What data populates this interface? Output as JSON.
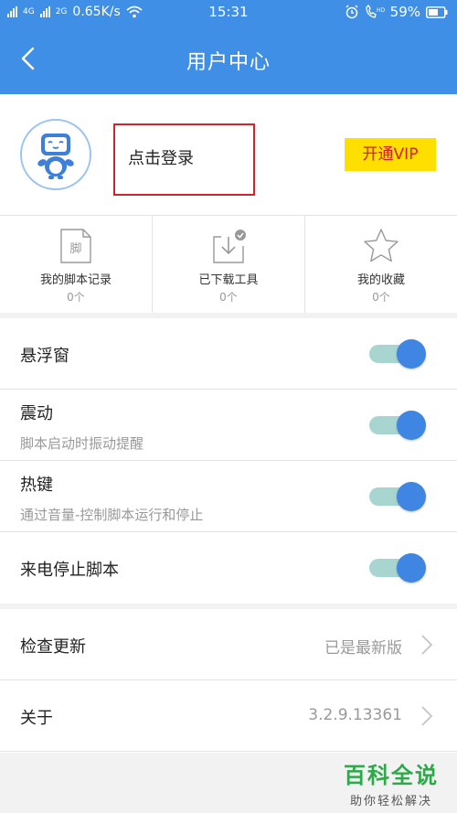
{
  "status_bar": {
    "network_left": "4G",
    "network_right": "2G",
    "speed": "0.65K/s",
    "time": "15:31",
    "battery": "59%"
  },
  "header": {
    "title": "用户中心",
    "back_icon": "back-arrow-icon"
  },
  "profile": {
    "avatar_icon": "robot-avatar-icon",
    "login_label": "点击登录",
    "vip_label": "开通VIP"
  },
  "quick_links": [
    {
      "label": "我的脚本记录",
      "count": "0个",
      "icon": "script-file-icon",
      "icon_text": "脚"
    },
    {
      "label": "已下载工具",
      "count": "0个",
      "icon": "download-icon"
    },
    {
      "label": "我的收藏",
      "count": "0个",
      "icon": "star-icon"
    }
  ],
  "settings": [
    {
      "title": "悬浮窗",
      "subtitle": "",
      "enabled": true
    },
    {
      "title": "震动",
      "subtitle": "脚本启动时振动提醒",
      "enabled": true
    },
    {
      "title": "热键",
      "subtitle": "通过音量-控制脚本运行和停止",
      "enabled": true
    },
    {
      "title": "来电停止脚本",
      "subtitle": "",
      "enabled": true
    }
  ],
  "about_rows": [
    {
      "title": "检查更新",
      "value": "已是最新版"
    },
    {
      "title": "关于",
      "value": "3.2.9.13361"
    }
  ],
  "watermark": {
    "line1": "百科全说",
    "line2": "助你轻松解决"
  },
  "colors": {
    "header_blue": "#3f8fe6",
    "vip_yellow": "#ffdf00",
    "vip_text_red": "#d31f1f",
    "toggle_knob": "#3f86e3",
    "toggle_track": "#a9d5d0",
    "highlight_box": "#c8282e"
  }
}
